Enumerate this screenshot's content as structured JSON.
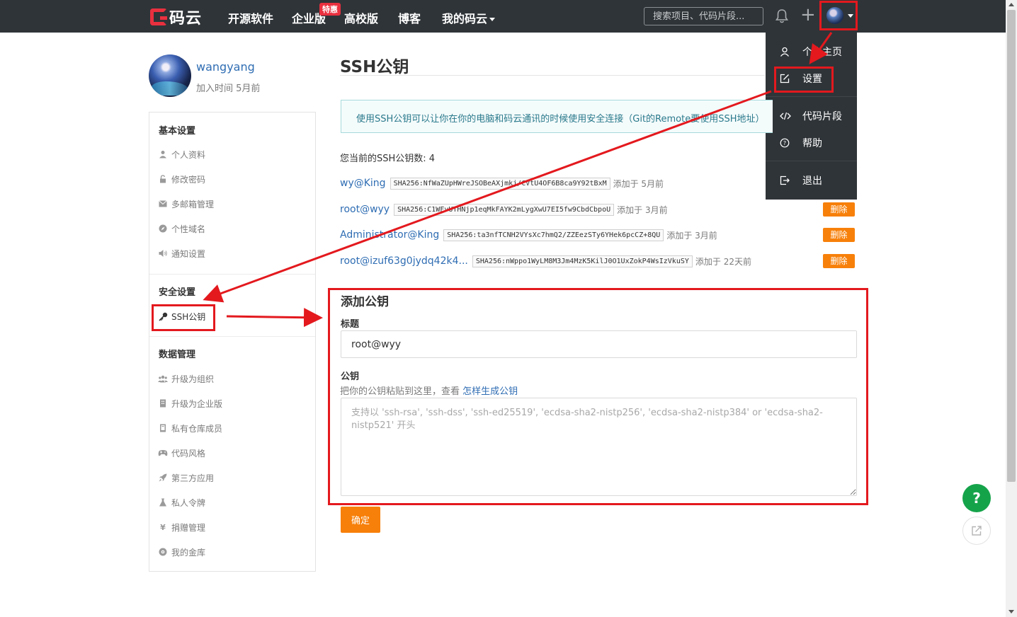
{
  "nav": {
    "logo_text": "码云",
    "items": [
      "开源软件",
      "企业版",
      "高校版",
      "博客",
      "我的码云"
    ],
    "badge": "特惠",
    "search_placeholder": "搜索项目、代码片段..."
  },
  "dropdown": {
    "items": [
      "个人主页",
      "设置",
      "代码片段",
      "帮助",
      "退出"
    ]
  },
  "profile": {
    "name": "wangyang",
    "joined": "加入时间 5月前"
  },
  "sidebar": {
    "basic_heading": "基本设置",
    "basic_items": [
      "个人资料",
      "修改密码",
      "多邮箱管理",
      "个性域名",
      "通知设置"
    ],
    "security_heading": "安全设置",
    "security_items": [
      "SSH公钥"
    ],
    "data_heading": "数据管理",
    "data_items": [
      "升级为组织",
      "升级为企业版",
      "私有仓库成员",
      "代码风格",
      "第三方应用",
      "私人令牌",
      "捐赠管理",
      "我的金库"
    ]
  },
  "main": {
    "title": "SSH公钥",
    "info": "使用SSH公钥可以让你在你的电脑和码云通讯的时候使用安全连接（Git的Remote要使用SSH地址）",
    "key_count": "您当前的SSH公钥数: 4",
    "keys": [
      {
        "name": "wy@King",
        "fingerprint": "SHA256:NfWaZUpHWreJSOBeAXjmkj/CVtU4OF6B8ca9Y92tBxM",
        "added": "添加于 5月前",
        "delete": "删除"
      },
      {
        "name": "root@wyy",
        "fingerprint": "SHA256:C1WFvUTHNjp1eqMkFAYK2mLygXwU7EI5fw9CbdCbpoU",
        "added": "添加于 3月前",
        "delete": "删除"
      },
      {
        "name": "Administrator@King",
        "fingerprint": "SHA256:ta3nfTCNH2VYsXc7hmQ2/ZZEezSTy6YHek6pcCZ+8QU",
        "added": "添加于 3月前",
        "delete": "删除"
      },
      {
        "name": "root@izuf63g0jydq42k4...",
        "fingerprint": "SHA256:nWppo1WyLM8M3Jm4MzK5KilJ0O1UxZokP4WsIzVkuSY",
        "added": "添加于 22天前",
        "delete": "删除"
      }
    ],
    "add_title": "添加公钥",
    "title_label": "标题",
    "title_value": "root@wyy",
    "key_label": "公钥",
    "key_hint": "把你的公钥粘贴到这里，查看",
    "key_hint_link": "怎样生成公钥",
    "key_placeholder": "支持以 'ssh-rsa', 'ssh-dss', 'ssh-ed25519', 'ecdsa-sha2-nistp256', 'ecdsa-sha2-nistp384' or 'ecdsa-sha2-nistp521' 开头",
    "submit": "确定"
  },
  "fab": {
    "help": "?"
  },
  "colors": {
    "nav_bg": "#2f3438",
    "accent_orange": "#f7800a",
    "link_blue": "#2f6db3",
    "annotation_red": "#e3191e",
    "help_green": "#15a34a"
  }
}
